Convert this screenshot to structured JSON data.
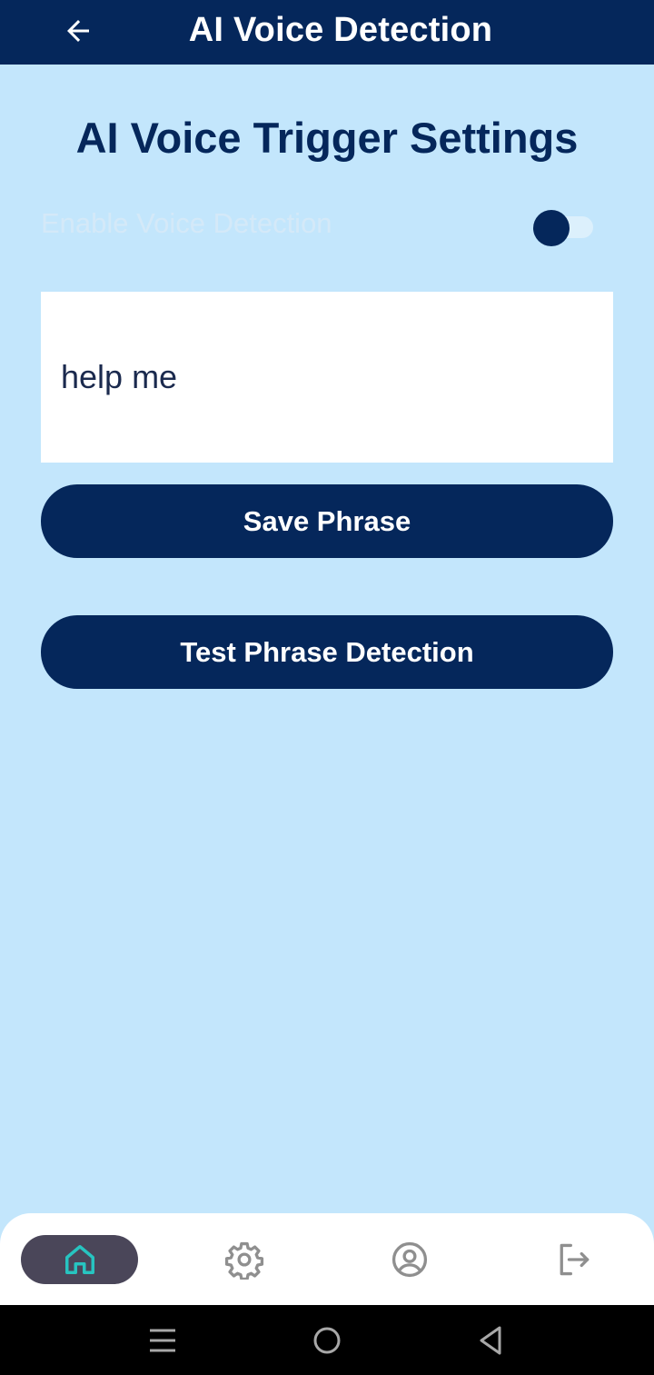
{
  "app_bar": {
    "title": "AI Voice Detection",
    "back_icon": "arrow-left-icon",
    "background": "#05275b"
  },
  "page": {
    "background": "#c3e6fc",
    "section_title": "AI Voice Trigger Settings"
  },
  "voice_detection": {
    "label": "Enable Voice Detection",
    "enabled": false
  },
  "phrase_input": {
    "value": "help me"
  },
  "buttons": {
    "save_label": "Save Phrase",
    "test_label": "Test Phrase Detection",
    "color": "#05275b"
  },
  "bottom_nav": {
    "items": [
      {
        "icon": "home-icon",
        "active": true,
        "accent": "#27c4c0"
      },
      {
        "icon": "gear-icon",
        "active": false
      },
      {
        "icon": "user-circle-icon",
        "active": false
      },
      {
        "icon": "logout-icon",
        "active": false
      }
    ]
  },
  "system_nav": {
    "items": [
      "menu-icon",
      "home-circle-icon",
      "back-triangle-icon"
    ]
  }
}
